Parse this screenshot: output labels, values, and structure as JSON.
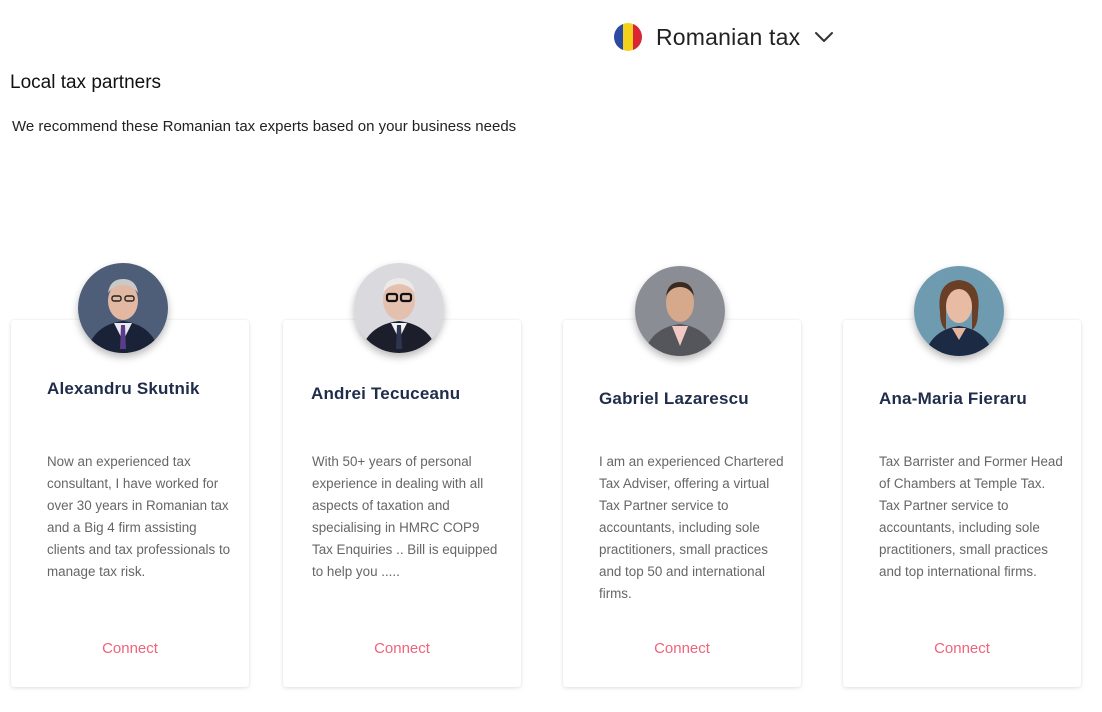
{
  "country_selector": {
    "label": "Romanian tax",
    "flag_colors": [
      "#2b4aa3",
      "#f4d21c",
      "#d92534"
    ]
  },
  "section": {
    "title": "Local tax partners",
    "subtitle": "We recommend these Romanian tax experts based on your business needs"
  },
  "partners": [
    {
      "name": "Alexandru Skutnik",
      "bio": "Now an experienced tax consultant, I have worked for over 30 years in Romanian tax and a Big 4 firm assisting clients and tax professionals to manage tax risk.",
      "connect_label": "Connect"
    },
    {
      "name": "Andrei Tecuceanu",
      "bio": "With 50+ years of personal experience in dealing with all aspects of taxation and specialising in HMRC COP9 Tax Enquiries .. Bill is equipped to help you .....",
      "connect_label": "Connect"
    },
    {
      "name": "Gabriel Lazarescu",
      "bio": "I am an experienced Chartered Tax Adviser, offering a virtual Tax Partner service to accountants, including sole practitioners, small practices and top 50 and international firms.",
      "connect_label": "Connect"
    },
    {
      "name": "Ana-Maria Fieraru",
      "bio": "Tax Barrister and Former Head of Chambers at Temple Tax. Tax Partner service to accountants, including sole practitioners, small practices and top international firms.",
      "connect_label": "Connect"
    }
  ],
  "colors": {
    "accent": "#f0647a",
    "name": "#1f2d4a",
    "bio": "#666666"
  }
}
